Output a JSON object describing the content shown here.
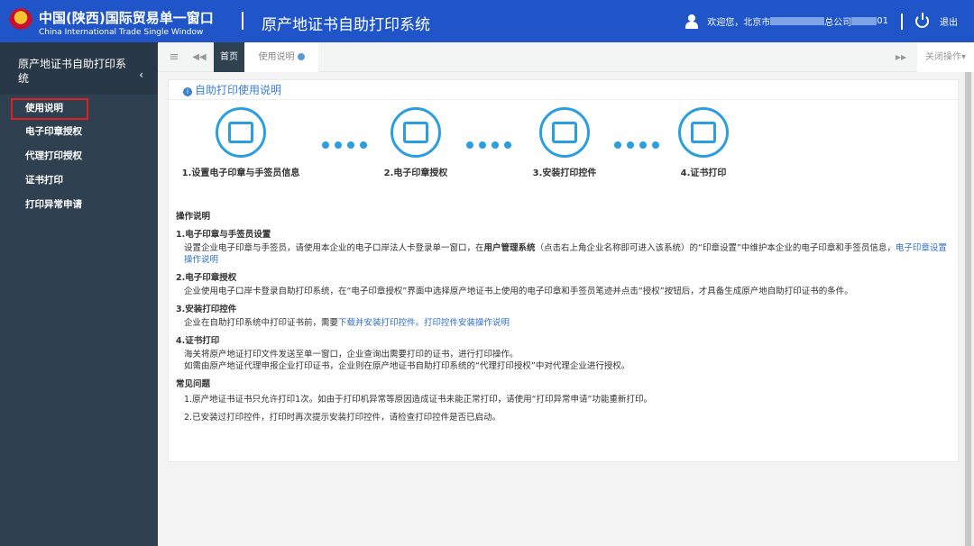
{
  "header": {
    "brand_cn": "中国(陕西)国际贸易单一窗口",
    "brand_en": "China International Trade Single Window",
    "system_title": "原产地证书自助打印系统",
    "welcome": "欢迎您，北京市",
    "company_suffix": "总公司",
    "user_suffix": "01",
    "logout": "退出"
  },
  "sidebar": {
    "title": "原产地证书自助打印系统",
    "items": [
      {
        "label": "使用说明",
        "active": true
      },
      {
        "label": "电子印章授权"
      },
      {
        "label": "代理打印授权"
      },
      {
        "label": "证书打印"
      },
      {
        "label": "打印异常申请"
      }
    ]
  },
  "tabs": {
    "home": "首页",
    "current": "使用说明",
    "close_ops": "关闭操作"
  },
  "panel": {
    "title": "自助打印使用说明",
    "steps": [
      {
        "label": "1.设置电子印章与手签员信息",
        "icon": "computer-settings-icon"
      },
      {
        "label": "2.电子印章授权",
        "icon": "keypad-touch-icon"
      },
      {
        "label": "3.安装打印控件",
        "icon": "monitor-check-icon"
      },
      {
        "label": "4.证书打印",
        "icon": "document-view-icon"
      }
    ],
    "ops_heading": "操作说明",
    "s1_title": "1.电子印章与手签员设置",
    "s1_a": "设置企业电子印章与手签员，请使用本企业的电子口岸法人卡登录单一窗口，在",
    "s1_bold": "用户管理系统",
    "s1_b": "（点击右上角企业名称即可进入该系统）的“印章设置”中维护本企业的电子印章和手签员信息，",
    "s1_link": "电子印章设置操作说明",
    "s2_title": "2.电子印章授权",
    "s2_text": "企业使用电子口岸卡登录自助打印系统，在“电子印章授权”界面中选择原产地证书上使用的电子印章和手签员笔迹并点击“授权”按钮后，才具备生成原产地自助打印证书的条件。",
    "s3_title": "3.安装打印控件",
    "s3_text": "企业在自助打印系统中打印证书前，需要",
    "s3_link1": "下载并安装打印控件。",
    "s3_link2": "打印控件安装操作说明",
    "s4_title": "4.证书打印",
    "s4_l1": "海关将原产地证打印文件发送至单一窗口，企业查询出需要打印的证书，进行打印操作。",
    "s4_l2": "如需由原产地证代理申报企业打印证书，企业则在原产地证书自助打印系统的“代理打印授权”中对代理企业进行授权。",
    "faq_heading": "常见问题",
    "faq": [
      "1.原产地证书证书只允许打印1次。如由于打印机异常等原因造成证书未能正常打印，请使用“打印异常申请”功能重新打印。",
      "2.已安装过打印控件，打印时再次提示安装打印控件，请检查打印控件是否已启动。"
    ]
  },
  "colors": {
    "header": "#1f55c8",
    "sidebar": "#2f4050",
    "accent": "#2a9ee0",
    "highlight": "#e02020"
  }
}
